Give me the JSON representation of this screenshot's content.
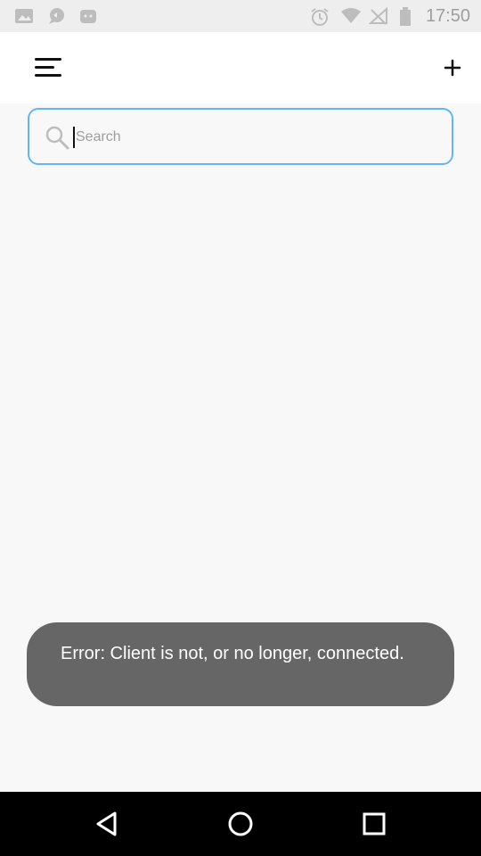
{
  "status_bar": {
    "time": "17:50",
    "left_icons": [
      "image-icon",
      "chat-icon",
      "android-icon"
    ],
    "right_icons": [
      "alarm-icon",
      "wifi-icon",
      "no-signal-icon",
      "battery-icon"
    ]
  },
  "app_bar": {
    "menu_icon": "menu-icon",
    "add_icon": "plus-icon"
  },
  "search": {
    "placeholder": "Search",
    "value": ""
  },
  "toast": {
    "message": "Error: Client is not, or no longer, connected."
  },
  "nav_bar": {
    "buttons": [
      "back-icon",
      "home-icon",
      "recents-icon"
    ]
  },
  "colors": {
    "accent_border": "#64b5f6",
    "toast_bg": "#666666",
    "background": "#f8f8f8"
  }
}
